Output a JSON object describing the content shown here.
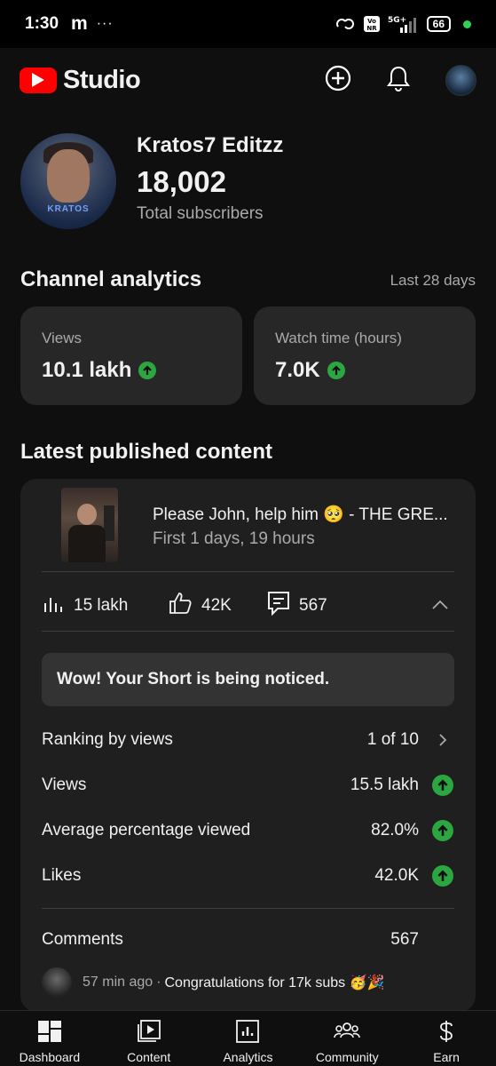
{
  "status_bar": {
    "time": "1:30",
    "carrier_icon": "m",
    "more": "···",
    "network": "5G+",
    "volte": "Vo NR",
    "battery": "66"
  },
  "app": {
    "title": "Studio",
    "icons": [
      "youtube-logo-icon",
      "create-icon",
      "notifications-icon",
      "account-avatar"
    ]
  },
  "channel": {
    "name": "Kratos7 Editzz",
    "avatar_text": "KRATOS",
    "subscribers": "18,002",
    "subscribers_label": "Total subscribers"
  },
  "analytics": {
    "title": "Channel analytics",
    "period": "Last 28 days",
    "cards": [
      {
        "label": "Views",
        "value": "10.1 lakh",
        "trend": "up"
      },
      {
        "label": "Watch time (hours)",
        "value": "7.0K",
        "trend": "up"
      }
    ]
  },
  "latest": {
    "title": "Latest published content",
    "video": {
      "title": "Please John, help him 🥺 - THE GRE...",
      "subtitle": "First 1 days, 19 hours",
      "views": "15 lakh",
      "likes": "42K",
      "comments": "567"
    },
    "notice": "Wow! Your Short is being noticed.",
    "rows": [
      {
        "label": "Ranking by views",
        "value": "1 of 10",
        "indicator": "chevron-right"
      },
      {
        "label": "Views",
        "value": "15.5 lakh",
        "indicator": "up"
      },
      {
        "label": "Average percentage viewed",
        "value": "82.0%",
        "indicator": "up"
      },
      {
        "label": "Likes",
        "value": "42.0K",
        "indicator": "up"
      }
    ],
    "comments_label": "Comments",
    "comments_value": "567",
    "latest_comment": {
      "ago": "57 min ago",
      "separator": "·",
      "text": "Congratulations for 17k subs 🥳🎉"
    }
  },
  "nav": [
    {
      "label": "Dashboard",
      "icon": "dashboard-icon"
    },
    {
      "label": "Content",
      "icon": "content-icon"
    },
    {
      "label": "Analytics",
      "icon": "analytics-icon"
    },
    {
      "label": "Community",
      "icon": "community-icon"
    },
    {
      "label": "Earn",
      "icon": "earn-icon"
    }
  ],
  "colors": {
    "background": "#0f0f0f",
    "card": "#272727",
    "accent_red": "#ff0000",
    "trend_green": "#2ba640",
    "secondary_text": "#aaaaaa"
  }
}
